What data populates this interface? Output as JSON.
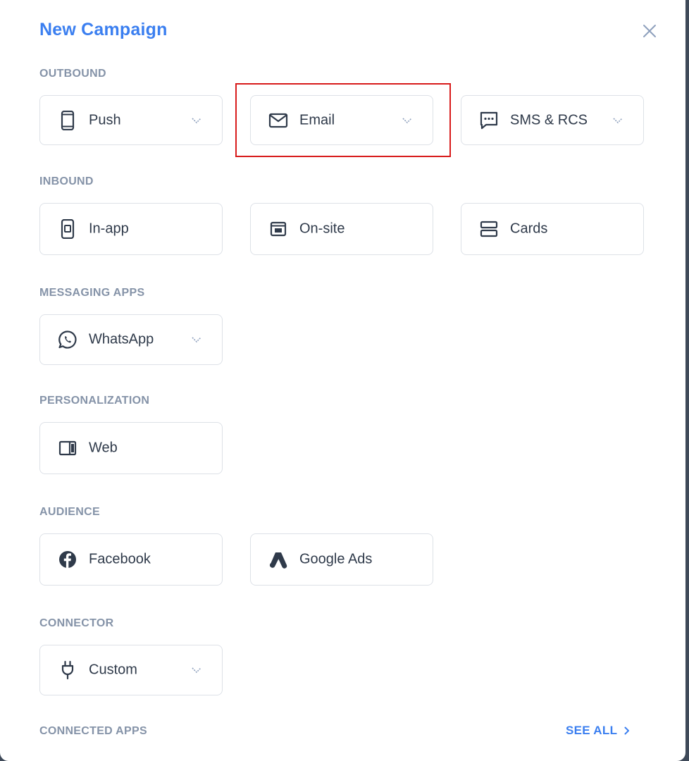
{
  "modal": {
    "title": "New Campaign",
    "close_icon": "close-icon"
  },
  "sections": {
    "outbound": {
      "label": "OUTBOUND",
      "items": [
        {
          "label": "Push",
          "icon": "mobile-phone-icon",
          "has_dropdown": true
        },
        {
          "label": "Email",
          "icon": "envelope-icon",
          "has_dropdown": true,
          "highlighted": true
        },
        {
          "label": "SMS & RCS",
          "icon": "chat-bubble-icon",
          "has_dropdown": true
        }
      ]
    },
    "inbound": {
      "label": "INBOUND",
      "items": [
        {
          "label": "In-app",
          "icon": "in-app-icon"
        },
        {
          "label": "On-site",
          "icon": "browser-window-icon"
        },
        {
          "label": "Cards",
          "icon": "cards-icon"
        }
      ]
    },
    "messaging_apps": {
      "label": "MESSAGING APPS",
      "items": [
        {
          "label": "WhatsApp",
          "icon": "whatsapp-icon",
          "has_dropdown": true
        }
      ]
    },
    "personalization": {
      "label": "PERSONALIZATION",
      "items": [
        {
          "label": "Web",
          "icon": "web-layout-icon"
        }
      ]
    },
    "audience": {
      "label": "AUDIENCE",
      "items": [
        {
          "label": "Facebook",
          "icon": "facebook-icon"
        },
        {
          "label": "Google Ads",
          "icon": "google-ads-icon"
        }
      ]
    },
    "connector": {
      "label": "CONNECTOR",
      "items": [
        {
          "label": "Custom",
          "icon": "plug-icon",
          "has_dropdown": true
        }
      ]
    },
    "connected_apps": {
      "label": "CONNECTED APPS",
      "see_all": "SEE ALL"
    }
  },
  "colors": {
    "accent": "#3b7ff0",
    "section_label": "#8593a8",
    "card_border": "#dde1e7",
    "icon": "#2f3a4a",
    "highlight": "#d81b1b"
  }
}
